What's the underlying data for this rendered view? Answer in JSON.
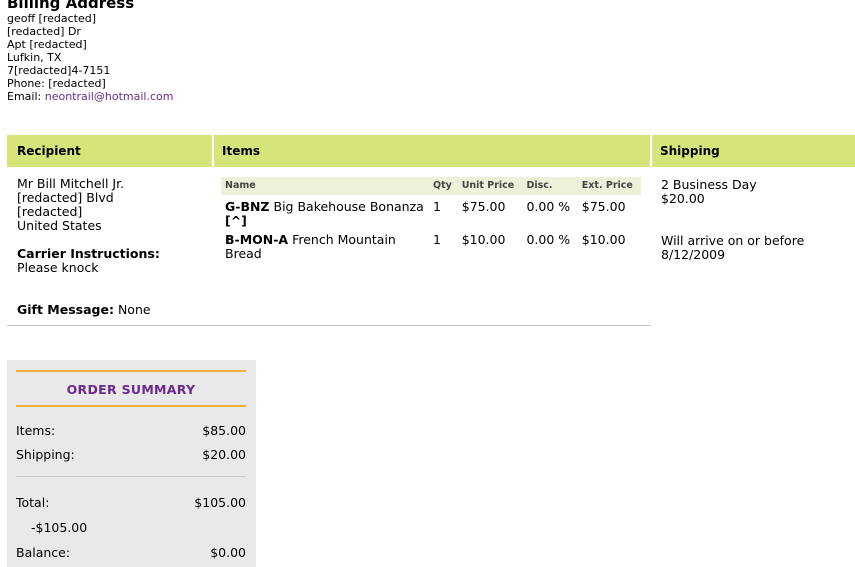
{
  "billing": {
    "heading": "Billing Address",
    "lines": [
      "geoff [redacted]",
      "[redacted] Dr",
      "Apt [redacted]",
      "Lufkin, TX",
      "7[redacted]4-7151"
    ],
    "phone_label": "Phone:",
    "phone_value": "[redacted]",
    "email_label": "Email:",
    "email": "neontrail@hotmail.com"
  },
  "order": {
    "headers": {
      "recipient": "Recipient",
      "items": "Items",
      "shipping": "Shipping"
    },
    "recipient": {
      "name": "Mr Bill Mitchell Jr.",
      "street": "[redacted] Blvd",
      "city_line": "[redacted]",
      "country": "United States",
      "carrier_label": "Carrier Instructions:",
      "carrier_value": "Please knock",
      "gift_label": "Gift Message:",
      "gift_value": "None"
    },
    "items_table": {
      "columns": [
        "Name",
        "Qty",
        "Unit Price",
        "Disc.",
        "Ext. Price"
      ],
      "rows": [
        {
          "sku": "G-BNZ",
          "name": "Big Bakehouse Bonanza",
          "link": "[^]",
          "qty": "1",
          "unit": "$75.00",
          "disc": "0.00 %",
          "ext": "$75.00"
        },
        {
          "sku": "B-MON-A",
          "name": "French Mountain Bread",
          "qty": "1",
          "unit": "$10.00",
          "disc": "0.00 %",
          "ext": "$10.00"
        }
      ]
    },
    "shipping": {
      "method": "2 Business Day",
      "cost": "$20.00",
      "arrival": "Will arrive on or before 8/12/2009"
    }
  },
  "summary": {
    "title": "ORDER SUMMARY",
    "items_label": "Items:",
    "items_value": "$85.00",
    "shipping_label": "Shipping:",
    "shipping_value": "$20.00",
    "total_label": "Total:",
    "total_value": "$105.00",
    "payment": "-$105.00",
    "balance_label": "Balance:",
    "balance_value": "$0.00"
  },
  "colors": {
    "header_bg": "#d6e47a",
    "accent_purple": "#6b2a8c",
    "accent_orange": "#f0b23a"
  }
}
